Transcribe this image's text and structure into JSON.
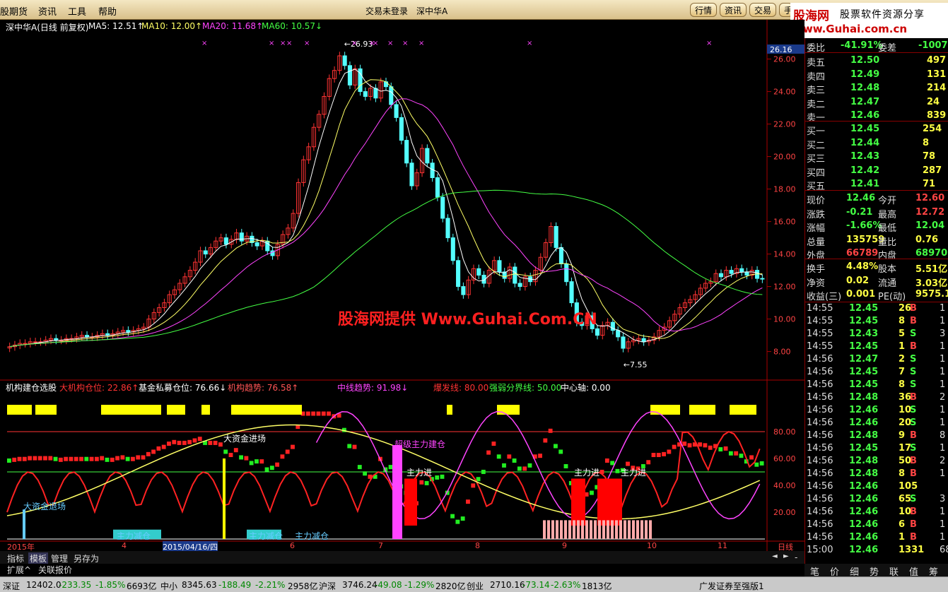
{
  "menu": {
    "items": [
      "股期货",
      "资讯",
      "工具",
      "帮助"
    ],
    "center_status": "交易未登录",
    "center_stock": "深中华A",
    "buttons": [
      "行情",
      "资讯",
      "交易",
      "手"
    ]
  },
  "logo": {
    "name": "股海网",
    "slogan": "股票软件资源分享",
    "url": "www.Guhai.com.cn"
  },
  "main_chart": {
    "title": "深中华A(日线 前复权)",
    "ma": [
      {
        "label": "MA5: 12.51",
        "arrow": "↑",
        "color": "#ffffff"
      },
      {
        "label": "MA10: 12.00",
        "arrow": "↑",
        "color": "#ffff66"
      },
      {
        "label": "MA20: 11.68",
        "arrow": "↑",
        "color": "#ff44ff"
      },
      {
        "label": "MA60: 10.57",
        "arrow": "↓",
        "color": "#44ff44"
      }
    ],
    "high_label": "26.93",
    "low_label": "7.55",
    "current_tag": "26.16",
    "y_ticks": [
      "26.00",
      "24.00",
      "22.00",
      "20.00",
      "18.00",
      "16.00",
      "14.00",
      "12.00",
      "10.00",
      "8.00"
    ]
  },
  "chart_data": {
    "type": "candlestick",
    "title": "深中华A(日线 前复权)",
    "y_range": [
      7.2,
      27.2
    ],
    "high": 26.93,
    "low": 7.55,
    "ma_legend": {
      "MA5": 12.51,
      "MA10": 12.0,
      "MA20": 11.68,
      "MA60": 10.57
    },
    "closes": [
      8.3,
      8.4,
      8.5,
      8.5,
      8.6,
      8.6,
      8.6,
      8.7,
      8.8,
      8.7,
      8.7,
      8.8,
      8.8,
      8.9,
      9.0,
      8.9,
      8.9,
      9.0,
      9.1,
      9.0,
      9.1,
      9.2,
      9.3,
      9.2,
      9.3,
      9.4,
      9.5,
      10.0,
      10.4,
      10.7,
      11.0,
      11.5,
      11.8,
      12.2,
      12.6,
      13.0,
      13.5,
      14.2,
      14.0,
      14.4,
      14.8,
      15.0,
      14.6,
      14.9,
      15.3,
      14.8,
      15.1,
      14.7,
      14.5,
      14.8,
      14.2,
      13.9,
      14.6,
      15.2,
      15.6,
      16.5,
      18.4,
      19.8,
      20.6,
      21.8,
      22.6,
      23.7,
      24.8,
      25.3,
      26.2,
      25.6,
      24.4,
      25.4,
      24.0,
      23.7,
      24.2,
      23.6,
      24.6,
      24.3,
      23.2,
      22.4,
      21.0,
      19.6,
      18.2,
      19.0,
      20.5,
      19.6,
      18.7,
      17.5,
      16.2,
      15.0,
      13.6,
      12.0,
      11.5,
      12.4,
      13.1,
      12.7,
      12.2,
      13.0,
      13.6,
      12.9,
      12.5,
      13.2,
      12.2,
      12.0,
      12.6,
      12.3,
      13.0,
      13.8,
      14.7,
      15.7,
      14.4,
      13.4,
      12.3,
      11.0,
      9.8,
      9.6,
      10.2,
      9.4,
      9.0,
      9.6,
      9.8,
      9.3,
      8.9,
      8.2,
      8.6,
      8.7,
      8.8,
      8.6,
      8.7,
      8.9,
      9.3,
      9.5,
      9.9,
      10.3,
      10.7,
      11.0,
      11.2,
      11.5,
      11.9,
      12.2,
      12.3,
      12.8,
      12.6,
      13.0,
      12.8,
      13.1,
      12.9,
      12.7,
      13.0,
      12.5,
      12.46
    ],
    "x_labels": [
      "2015年",
      "4",
      "2015/04/16/四",
      "6",
      "7",
      "8",
      "9",
      "10",
      "11",
      "日线"
    ]
  },
  "indicator": {
    "name": "机构建仓选股",
    "items": [
      {
        "label": "大机构仓位: 22.86",
        "arrow": "↑",
        "color": "#ff3333"
      },
      {
        "label": "基金私募仓位: 76.66",
        "arrow": "↓",
        "color": "#ffffff"
      },
      {
        "label": "机构趋势: 76.58",
        "arrow": "↑",
        "color": "#ff5555"
      },
      {
        "label": "中线趋势: 91.98",
        "arrow": "↓",
        "color": "#ff44ff"
      },
      {
        "label": "爆发线: 80.00",
        "arrow": "",
        "color": "#ff3333"
      },
      {
        "label": "强弱分界线: 50.00",
        "arrow": "",
        "color": "#44ff44"
      },
      {
        "label": "中心轴: 0.00",
        "arrow": "",
        "color": "#ffffff"
      }
    ],
    "y_ticks": [
      "80.00",
      "60.00",
      "40.00",
      "20.00"
    ],
    "annotations": [
      {
        "text": "大资金进场",
        "color": "#ffffff"
      },
      {
        "text": "大资金退场",
        "color": "#66ccff"
      },
      {
        "text": "主力减仓",
        "color": "#66ccff"
      },
      {
        "text": "主力减仓",
        "color": "#66ccff"
      },
      {
        "text": "主力减仓",
        "color": "#66ccff"
      },
      {
        "text": "超级主力建仓",
        "color": "#ff44ff"
      },
      {
        "text": "主力进",
        "color": "#ffffff"
      },
      {
        "text": "主力进",
        "color": "#ffffff"
      },
      {
        "text": "主力进",
        "color": "#ffffff"
      }
    ]
  },
  "watermark": "股海网提供 Www.Guhai.Com.CN",
  "bottom_tabs": [
    "指标",
    "模板",
    "管理",
    "另存为"
  ],
  "bottom_tabs2": [
    "扩展^",
    "关联报价"
  ],
  "quote": {
    "weibi": {
      "label": "委比",
      "value": "-41.91%",
      "label2": "委差",
      "value2": "-1007"
    },
    "sells": [
      {
        "label": "卖五",
        "price": "12.50",
        "vol": "497"
      },
      {
        "label": "卖四",
        "price": "12.49",
        "vol": "131"
      },
      {
        "label": "卖三",
        "price": "12.48",
        "vol": "214"
      },
      {
        "label": "卖二",
        "price": "12.47",
        "vol": "24"
      },
      {
        "label": "卖一",
        "price": "12.46",
        "vol": "839"
      }
    ],
    "buys": [
      {
        "label": "买一",
        "price": "12.45",
        "vol": "254"
      },
      {
        "label": "买二",
        "price": "12.44",
        "vol": "8"
      },
      {
        "label": "买三",
        "price": "12.43",
        "vol": "78"
      },
      {
        "label": "买四",
        "price": "12.42",
        "vol": "287"
      },
      {
        "label": "买五",
        "price": "12.41",
        "vol": "71"
      }
    ],
    "stats": [
      [
        "现价",
        "12.46",
        "今开",
        "12.60"
      ],
      [
        "涨跌",
        "-0.21",
        "最高",
        "12.72"
      ],
      [
        "涨幅",
        "-1.66%",
        "最低",
        "12.04"
      ],
      [
        "总量",
        "135759",
        "量比",
        "0.76"
      ],
      [
        "外盘",
        "66789",
        "内盘",
        "68970"
      ]
    ],
    "stats2": [
      [
        "换手",
        "4.48%",
        "股本",
        "5.51亿"
      ],
      [
        "净资",
        "0.02",
        "流通",
        "3.03亿"
      ],
      [
        "收益(三)",
        "0.001",
        "PE(动)",
        "9575.1"
      ]
    ],
    "ticks": [
      [
        "14:55",
        "12.45",
        "26",
        "B"
      ],
      [
        "14:55",
        "12.45",
        "8",
        "B"
      ],
      [
        "14:55",
        "12.43",
        "5",
        "S"
      ],
      [
        "14:55",
        "12.45",
        "1",
        "B"
      ],
      [
        "14:56",
        "12.47",
        "2",
        "S"
      ],
      [
        "14:56",
        "12.45",
        "7",
        "S"
      ],
      [
        "14:56",
        "12.45",
        "8",
        "S"
      ],
      [
        "14:56",
        "12.48",
        "36",
        "B"
      ],
      [
        "14:56",
        "12.46",
        "10",
        "S"
      ],
      [
        "14:56",
        "12.46",
        "20",
        "S"
      ],
      [
        "14:56",
        "12.48",
        "9",
        "B"
      ],
      [
        "14:56",
        "12.45",
        "17",
        "S"
      ],
      [
        "14:56",
        "12.48",
        "50",
        "B"
      ],
      [
        "14:56",
        "12.48",
        "8",
        "B"
      ],
      [
        "14:56",
        "12.46",
        "105",
        ""
      ],
      [
        "14:56",
        "12.46",
        "65",
        "S"
      ],
      [
        "14:56",
        "12.46",
        "10",
        "B"
      ],
      [
        "14:56",
        "12.46",
        "6",
        "B"
      ],
      [
        "14:56",
        "12.46",
        "1",
        "B"
      ],
      [
        "15:00",
        "12.46",
        "1331",
        ""
      ]
    ],
    "tick_right": [
      "1",
      "1",
      "3",
      "1",
      "1",
      "1",
      "1",
      "2",
      "1",
      "1",
      "8",
      "1",
      "2",
      "1",
      "",
      "3",
      "1",
      "1",
      "1",
      "68"
    ]
  },
  "right_tabs": [
    "笔",
    "价",
    "细",
    "势",
    "联",
    "值",
    "筹"
  ],
  "status": [
    {
      "t": "深证",
      "c": "#000"
    },
    {
      "t": "12402.0",
      "c": "#000"
    },
    {
      "t": "-233.35",
      "c": "#008800"
    },
    {
      "t": "-1.85%",
      "c": "#008800"
    },
    {
      "t": "6693亿",
      "c": "#000"
    },
    {
      "t": "中小",
      "c": "#000"
    },
    {
      "t": "8345.63",
      "c": "#000"
    },
    {
      "t": "-188.49",
      "c": "#008800"
    },
    {
      "t": "-2.21%",
      "c": "#008800"
    },
    {
      "t": "2958亿",
      "c": "#000"
    },
    {
      "t": "沪深",
      "c": "#000"
    },
    {
      "t": "3746.24",
      "c": "#000"
    },
    {
      "t": "-49.08",
      "c": "#008800"
    },
    {
      "t": "-1.29%",
      "c": "#008800"
    },
    {
      "t": "2820亿",
      "c": "#000"
    },
    {
      "t": "创业",
      "c": "#000"
    },
    {
      "t": "2710.16",
      "c": "#000"
    },
    {
      "t": "-73.14",
      "c": "#008800"
    },
    {
      "t": "-2.63%",
      "c": "#008800"
    },
    {
      "t": "1813亿",
      "c": "#000"
    },
    {
      "t": "广发证券至强版1",
      "c": "#000"
    }
  ]
}
